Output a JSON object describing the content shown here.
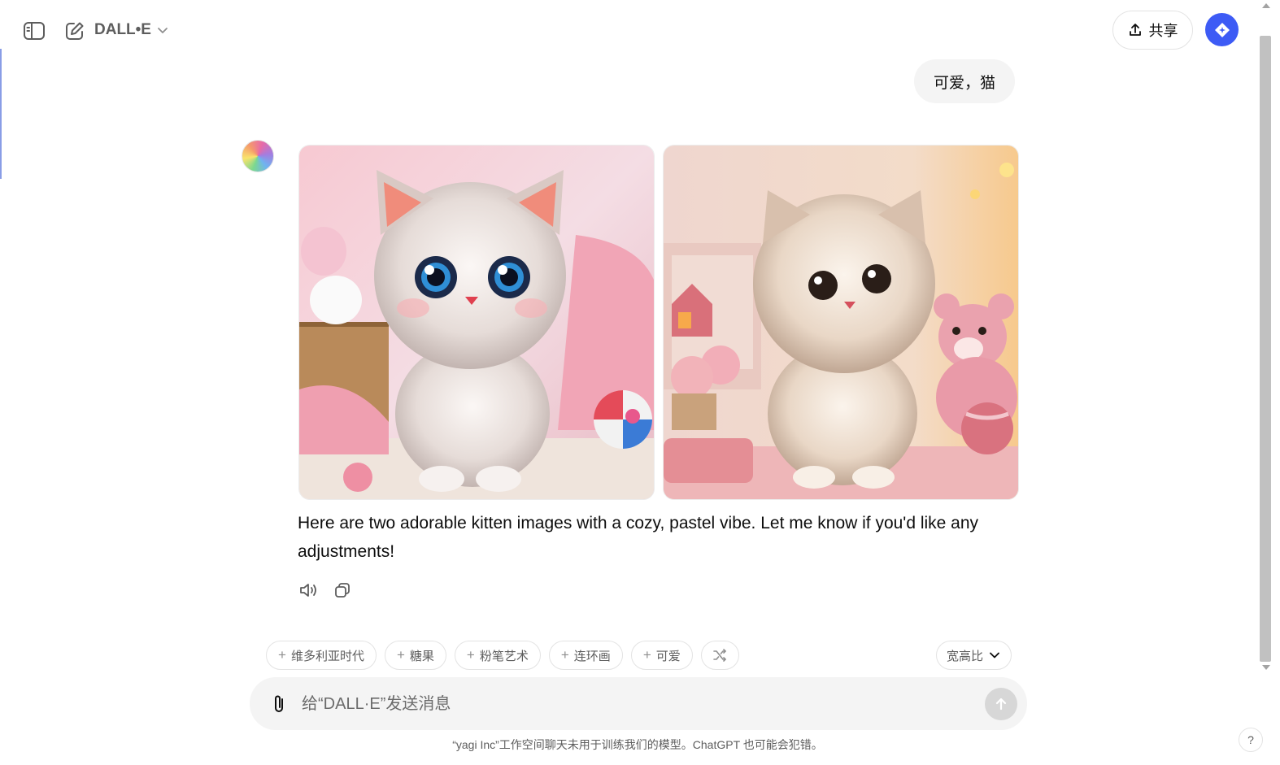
{
  "header": {
    "model_name": "DALL•E",
    "share_label": "共享"
  },
  "conversation": {
    "user_message": "可爱，猫",
    "assistant_message": "Here are two adorable kitten images with a cozy, pastel vibe. Let me know if you'd like any adjustments!"
  },
  "suggestions": {
    "chips": [
      "维多利亚时代",
      "糖果",
      "粉笔艺术",
      "连环画",
      "可爱"
    ],
    "aspect_label": "宽高比"
  },
  "composer": {
    "placeholder": "给“DALL·E”发送消息"
  },
  "footer": {
    "disclaimer": "“yagi Inc”工作空间聊天未用于训练我们的模型。ChatGPT 也可能会犯错。",
    "help_label": "?"
  },
  "colors": {
    "accent_badge": "#3d5bf5",
    "bubble_bg": "#f4f4f4",
    "send_disabled": "#d7d7d7"
  },
  "icons": [
    "sidebar-toggle-icon",
    "new-chat-icon",
    "chevron-down-icon",
    "share-upload-icon",
    "workspace-badge-icon",
    "speaker-icon",
    "copy-icon",
    "shuffle-icon",
    "paperclip-icon",
    "arrow-up-icon"
  ]
}
